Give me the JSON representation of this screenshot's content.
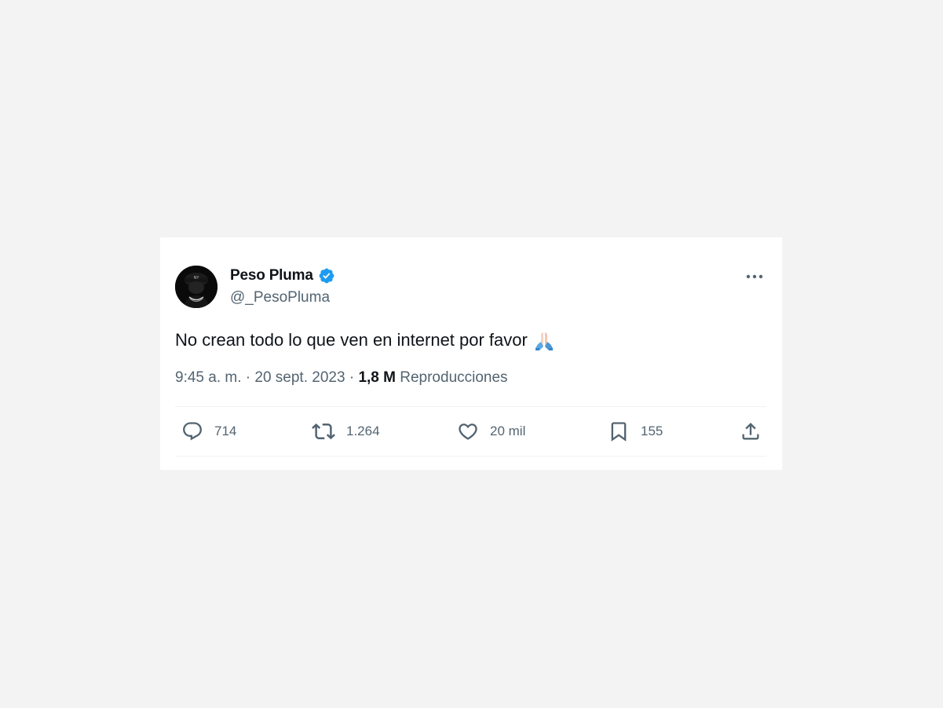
{
  "tweet": {
    "author": {
      "display_name": "Peso Pluma",
      "handle": "@_PesoPluma",
      "verified": true,
      "avatar_icon": "profile-photo"
    },
    "text": "No crean todo lo que ven en internet por favor",
    "emoji": "folded-hands",
    "time": "9:45 a. m.",
    "separator": "·",
    "date": "20 sept. 2023",
    "views_count": "1,8 M",
    "views_label": "Reproducciones",
    "more_icon": "ellipsis-icon"
  },
  "actions": {
    "reply": {
      "icon": "reply-icon",
      "count": "714"
    },
    "retweet": {
      "icon": "retweet-icon",
      "count": "1.264"
    },
    "like": {
      "icon": "heart-icon",
      "count": "20 mil"
    },
    "bookmark": {
      "icon": "bookmark-icon",
      "count": "155"
    },
    "share": {
      "icon": "share-icon"
    }
  },
  "colors": {
    "background": "#f3f3f3",
    "card": "#ffffff",
    "text_primary": "#0f1419",
    "text_secondary": "#536471",
    "verified_blue": "#1d9bf0",
    "divider": "#eff3f4"
  }
}
